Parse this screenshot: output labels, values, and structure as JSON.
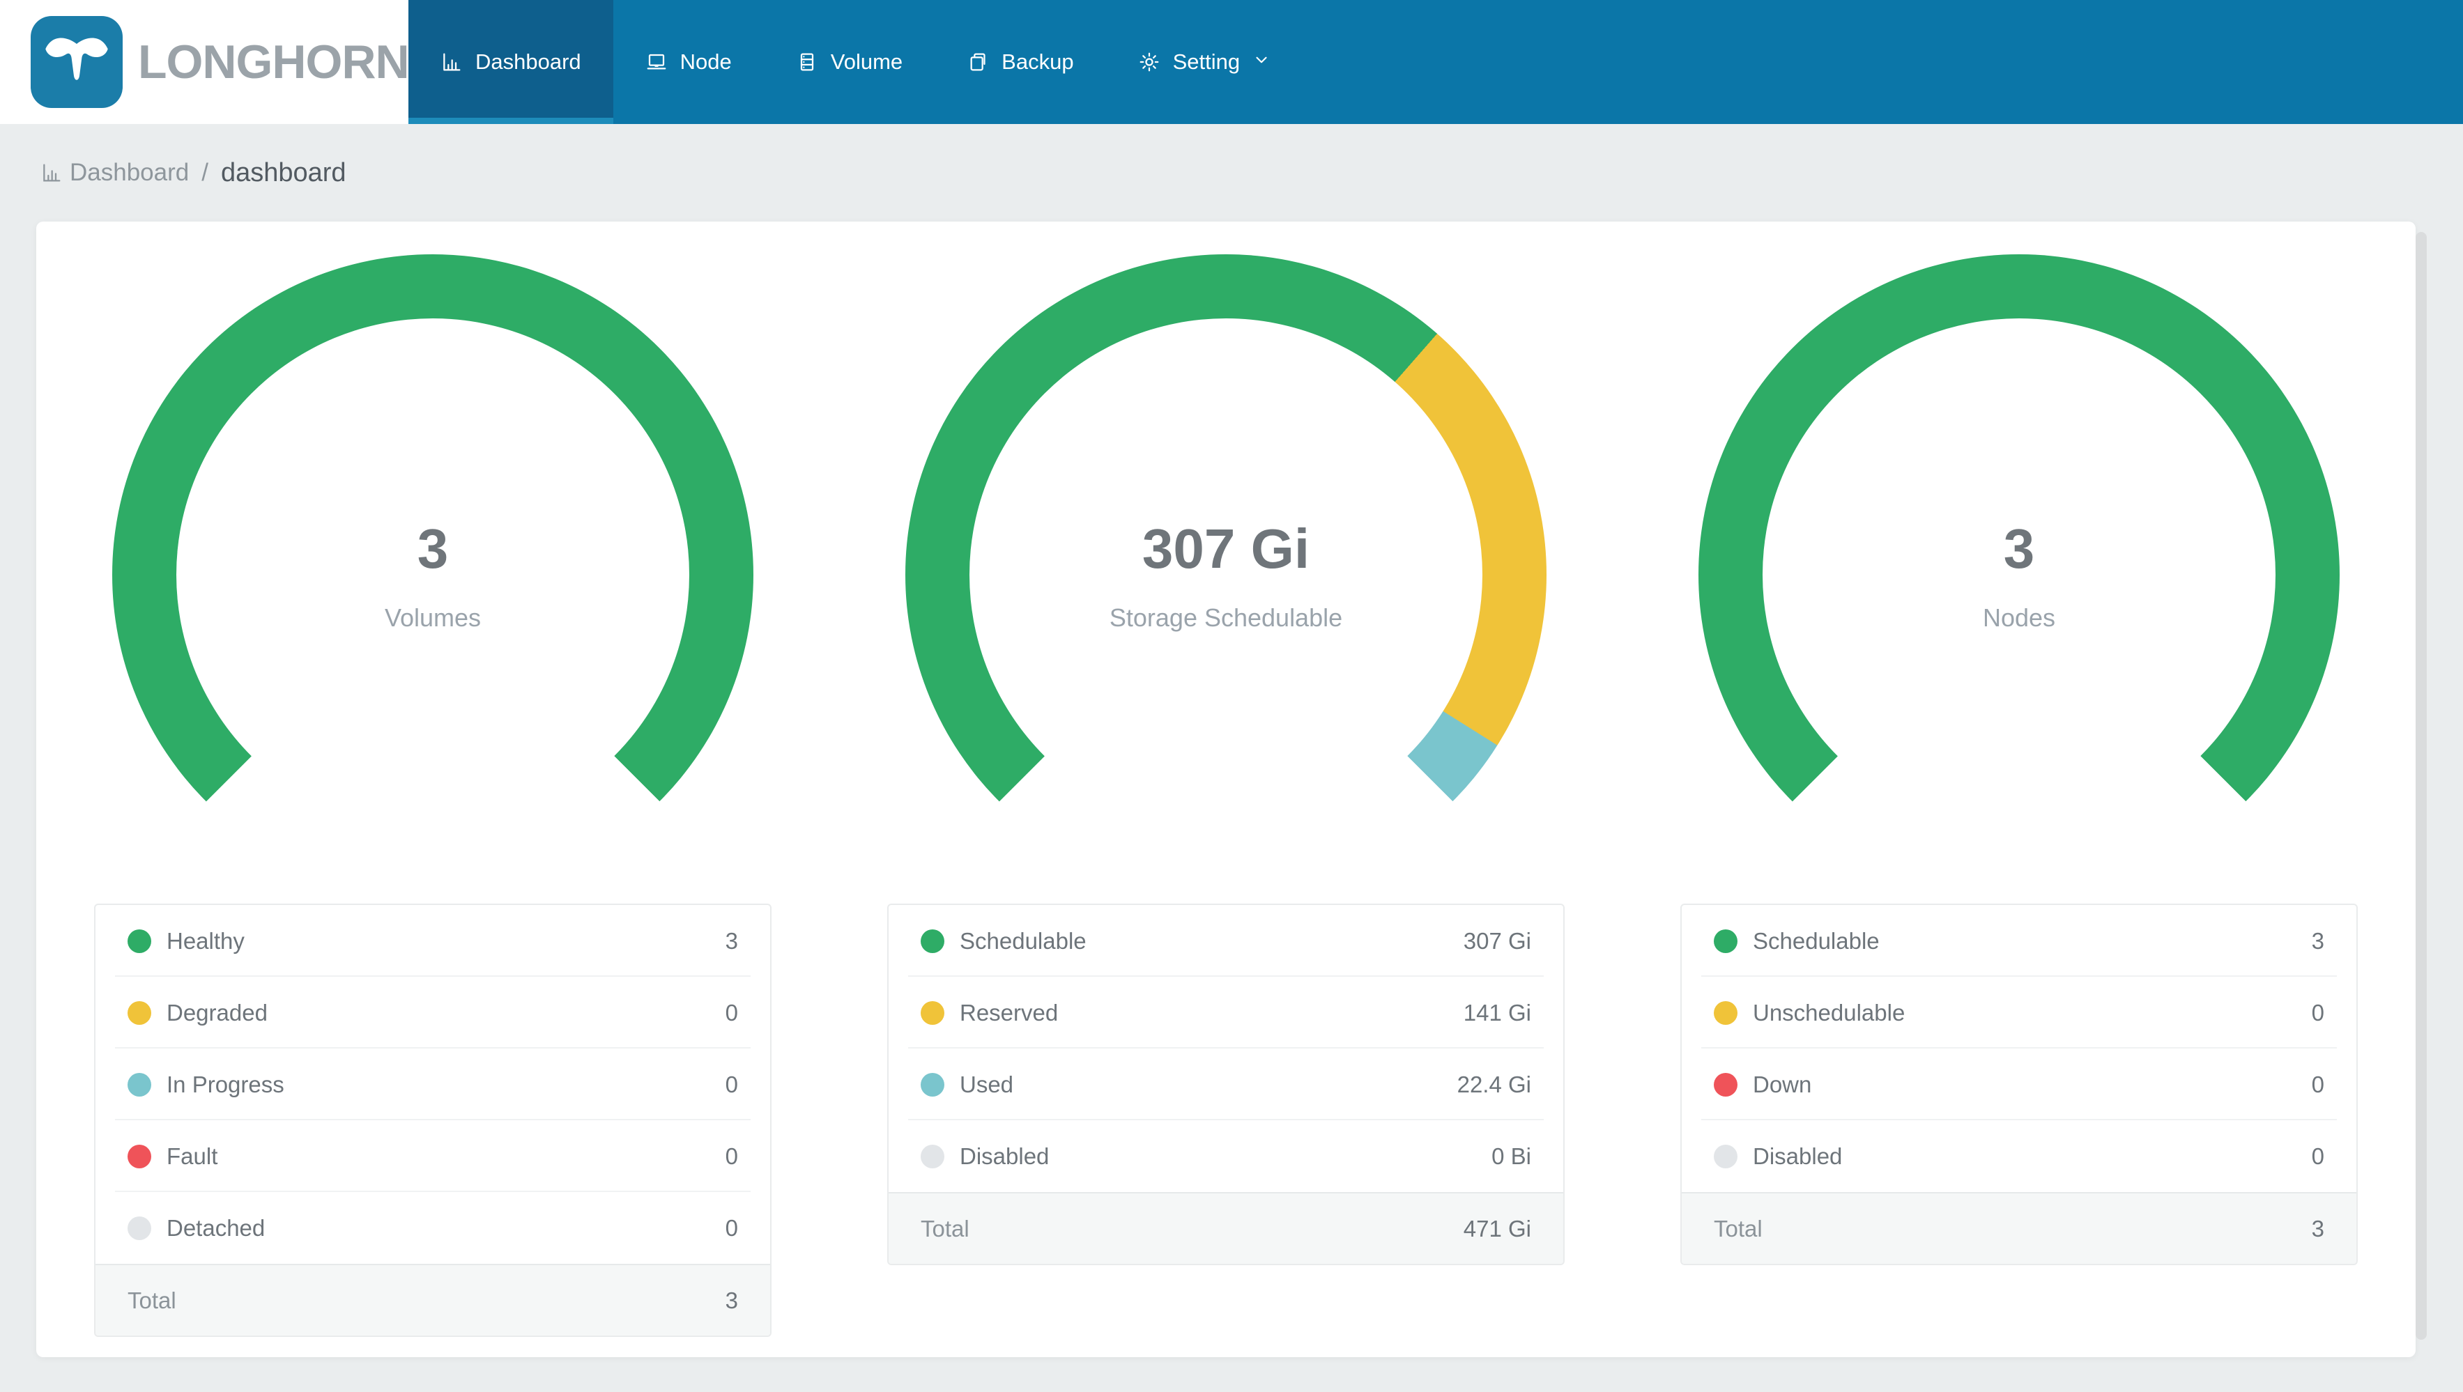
{
  "brand": {
    "name": "LONGHORN"
  },
  "nav": {
    "items": [
      {
        "label": "Dashboard",
        "icon": "bar-chart-icon",
        "active": true
      },
      {
        "label": "Node",
        "icon": "laptop-icon",
        "active": false
      },
      {
        "label": "Volume",
        "icon": "database-icon",
        "active": false
      },
      {
        "label": "Backup",
        "icon": "copy-icon",
        "active": false
      },
      {
        "label": "Setting",
        "icon": "gear-icon",
        "active": false,
        "has_chevron": true
      }
    ]
  },
  "breadcrumb": {
    "icon": "bar-chart-icon",
    "root": "Dashboard",
    "separator": "/",
    "current": "dashboard"
  },
  "colors": {
    "nav_bg": "#0b76a8",
    "nav_active_bg": "#0e5f8d",
    "nav_active_underline": "#1d8cba",
    "page_bg": "#eaedee",
    "green": "#2eac66",
    "yellow": "#f0c339",
    "teal": "#7ac5cd",
    "red": "#ef5359",
    "gray": "#e2e5e8",
    "value_text": "#6f757a",
    "muted_text": "#9aa3ab"
  },
  "chart_data": [
    {
      "type": "gauge",
      "title": "Volumes",
      "center_text": "3",
      "arc_degrees": 270,
      "start_angle_conic": 225,
      "segments": [
        {
          "name": "Healthy",
          "value": 3,
          "color": "#2eac66"
        },
        {
          "name": "Degraded",
          "value": 0,
          "color": "#f0c339"
        },
        {
          "name": "In Progress",
          "value": 0,
          "color": "#7ac5cd"
        },
        {
          "name": "Fault",
          "value": 0,
          "color": "#ef5359"
        },
        {
          "name": "Detached",
          "value": 0,
          "color": "#e2e5e8"
        }
      ],
      "total": 3
    },
    {
      "type": "gauge",
      "title": "Storage Schedulable",
      "center_text": "307 Gi",
      "arc_degrees": 270,
      "start_angle_conic": 225,
      "unit": "Gi",
      "segments": [
        {
          "name": "Schedulable",
          "value": 307,
          "color": "#2eac66"
        },
        {
          "name": "Reserved",
          "value": 141,
          "color": "#f0c339"
        },
        {
          "name": "Used",
          "value": 22.4,
          "color": "#7ac5cd"
        },
        {
          "name": "Disabled",
          "value": 0,
          "color": "#e2e5e8"
        }
      ],
      "total": 471
    },
    {
      "type": "gauge",
      "title": "Nodes",
      "center_text": "3",
      "arc_degrees": 270,
      "start_angle_conic": 225,
      "segments": [
        {
          "name": "Schedulable",
          "value": 3,
          "color": "#2eac66"
        },
        {
          "name": "Unschedulable",
          "value": 0,
          "color": "#f0c339"
        },
        {
          "name": "Down",
          "value": 0,
          "color": "#ef5359"
        },
        {
          "name": "Disabled",
          "value": 0,
          "color": "#e2e5e8"
        }
      ],
      "total": 3
    }
  ],
  "panels": [
    {
      "center_value": "3",
      "center_label": "Volumes",
      "rows": [
        {
          "label": "Healthy",
          "value": "3",
          "color": "#2eac66"
        },
        {
          "label": "Degraded",
          "value": "0",
          "color": "#f0c339"
        },
        {
          "label": "In Progress",
          "value": "0",
          "color": "#7ac5cd"
        },
        {
          "label": "Fault",
          "value": "0",
          "color": "#ef5359"
        },
        {
          "label": "Detached",
          "value": "0",
          "color": "#e2e5e8"
        }
      ],
      "total_label": "Total",
      "total_value": "3"
    },
    {
      "center_value": "307 Gi",
      "center_label": "Storage Schedulable",
      "rows": [
        {
          "label": "Schedulable",
          "value": "307 Gi",
          "color": "#2eac66"
        },
        {
          "label": "Reserved",
          "value": "141 Gi",
          "color": "#f0c339"
        },
        {
          "label": "Used",
          "value": "22.4 Gi",
          "color": "#7ac5cd"
        },
        {
          "label": "Disabled",
          "value": "0 Bi",
          "color": "#e2e5e8"
        }
      ],
      "total_label": "Total",
      "total_value": "471 Gi"
    },
    {
      "center_value": "3",
      "center_label": "Nodes",
      "rows": [
        {
          "label": "Schedulable",
          "value": "3",
          "color": "#2eac66"
        },
        {
          "label": "Unschedulable",
          "value": "0",
          "color": "#f0c339"
        },
        {
          "label": "Down",
          "value": "0",
          "color": "#ef5359"
        },
        {
          "label": "Disabled",
          "value": "0",
          "color": "#e2e5e8"
        }
      ],
      "total_label": "Total",
      "total_value": "3"
    }
  ]
}
